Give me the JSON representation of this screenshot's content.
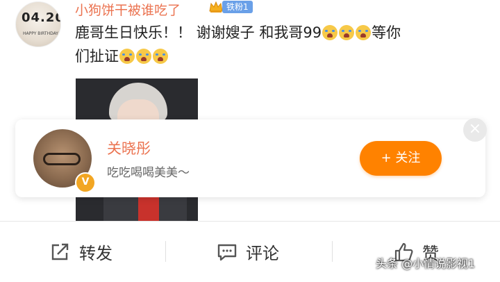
{
  "post": {
    "avatar_text": "04.20",
    "avatar_caption": "HAPPY BIRTHDAY",
    "username": "小狗饼干被谁吃了",
    "fan_badge": "铁粉1",
    "text_line1": "鹿哥生日快乐！！ 谢谢嫂子 和我哥99",
    "text_line1_tail": "等你",
    "text_line2": "们扯证"
  },
  "popup_card": {
    "name": "关晓彤",
    "description": "吃吃喝喝美美～",
    "verified_badge": "V",
    "follow_button": "+ 关注",
    "close_glyph": "×"
  },
  "action_bar": {
    "repost": "转发",
    "comment": "评论",
    "like": "赞"
  },
  "watermark": "头条 @小情说影视1",
  "colors": {
    "username": "#eb7350",
    "follow_button": "#ff8200",
    "fan_badge": "#6aa0e8",
    "verified": "#f2a623"
  },
  "icons": [
    "crown-icon",
    "crying-emoji-icon",
    "close-icon",
    "verified-icon",
    "repost-icon",
    "comment-icon",
    "like-icon"
  ]
}
